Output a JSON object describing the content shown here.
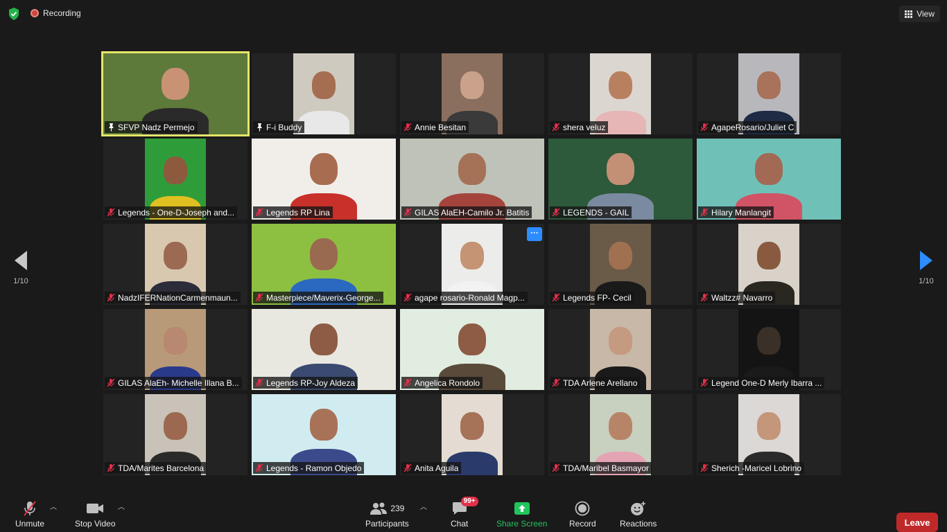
{
  "topbar": {
    "recording_label": "Recording",
    "view_label": "View"
  },
  "pager": {
    "left_page": "1/10",
    "right_page": "1/10"
  },
  "participants": [
    {
      "name": "SFVP Nadz Permejo",
      "icon": "pin-icon",
      "active": true,
      "bg": "#5d7a3a",
      "skin": "#c99275",
      "shirt": "#2a2a2a",
      "wide": true
    },
    {
      "name": "F-i Buddy",
      "icon": "pin-icon",
      "active": false,
      "bg": "#cfcac0",
      "skin": "#a56e52",
      "shirt": "#e8e8e8",
      "wide": false
    },
    {
      "name": "Annie Besitan",
      "icon": "mic-muted-icon",
      "active": false,
      "bg": "#8a6e5e",
      "skin": "#caa18a",
      "shirt": "#3a3a3a",
      "wide": false
    },
    {
      "name": "shera veluz",
      "icon": "mic-muted-icon",
      "active": false,
      "bg": "#dcd6d0",
      "skin": "#b98060",
      "shirt": "#e6b6b6",
      "wide": false
    },
    {
      "name": "AgapeRosario/Juliet C",
      "icon": "mic-muted-icon",
      "active": false,
      "bg": "#b8b8bc",
      "skin": "#a9725b",
      "shirt": "#1f2a44",
      "wide": false
    },
    {
      "name": "Legends - One-D-Joseph and...",
      "icon": "mic-muted-icon",
      "active": false,
      "bg": "#2f9c3a",
      "skin": "#8d5a3e",
      "shirt": "#e0c020",
      "wide": false
    },
    {
      "name": "Legends RP Lina",
      "icon": "mic-muted-icon",
      "active": false,
      "bg": "#f1eeea",
      "skin": "#a86c50",
      "shirt": "#c8302a",
      "wide": true
    },
    {
      "name": "GILAS AlaEH-Camilo Jr. Batitis",
      "icon": "mic-muted-icon",
      "active": false,
      "bg": "#bfc2b8",
      "skin": "#a57258",
      "shirt": "#a4443c",
      "wide": true
    },
    {
      "name": "LEGENDS - GAIL",
      "icon": "mic-muted-icon",
      "active": false,
      "bg": "#2c5a3a",
      "skin": "#c49075",
      "shirt": "#7a8aa0",
      "wide": true
    },
    {
      "name": "Hilary Manlangit",
      "icon": "mic-muted-icon",
      "active": false,
      "bg": "#6fc1b8",
      "skin": "#a26a55",
      "shirt": "#d05466",
      "wide": true
    },
    {
      "name": "NadzIFERNationCarmenmaun...",
      "icon": "mic-muted-icon",
      "active": false,
      "bg": "#d8c8b0",
      "skin": "#9c6a52",
      "shirt": "#2c2c3a",
      "wide": false
    },
    {
      "name": "Masterpiece/Maverix-George...",
      "icon": "mic-muted-icon",
      "active": false,
      "bg": "#8dc040",
      "skin": "#9a6a50",
      "shirt": "#2b68c0",
      "wide": true
    },
    {
      "name": "agape rosario-Ronald Magp...",
      "icon": "mic-muted-icon",
      "active": false,
      "bg": "#ececea",
      "skin": "#c49474",
      "shirt": "#f2f2f2",
      "wide": false
    },
    {
      "name": "Legends FP- Cecil",
      "icon": "mic-muted-icon",
      "active": false,
      "bg": "#6a5a48",
      "skin": "#a07050",
      "shirt": "#1a1a1a",
      "wide": false
    },
    {
      "name": "Waltzz# Navarro",
      "icon": "mic-muted-icon",
      "active": false,
      "bg": "#d8d2c8",
      "skin": "#8a5a40",
      "shirt": "#2a2620",
      "wide": false
    },
    {
      "name": "GILAS AlaEh- Michelle Illana B...",
      "icon": "mic-muted-icon",
      "active": false,
      "bg": "#b89a78",
      "skin": "#b88870",
      "shirt": "#2a3a8a",
      "wide": false
    },
    {
      "name": "Legends RP-Joy Aldeza",
      "icon": "mic-muted-icon",
      "active": false,
      "bg": "#e8e8e0",
      "skin": "#8e5c44",
      "shirt": "#3a4a70",
      "wide": true
    },
    {
      "name": "Angelica Rondolo",
      "icon": "mic-muted-icon",
      "active": false,
      "bg": "#e0ede0",
      "skin": "#8e5c44",
      "shirt": "#5a4a3a",
      "wide": true
    },
    {
      "name": "TDA Arlene Arellano",
      "icon": "mic-muted-icon",
      "active": false,
      "bg": "#c8b8a8",
      "skin": "#c49a80",
      "shirt": "#1a1a1a",
      "wide": false
    },
    {
      "name": "Legend One-D Merly Ibarra ...",
      "icon": "mic-muted-icon",
      "active": false,
      "bg": "#141414",
      "skin": "#3a3028",
      "shirt": "#1a1a1a",
      "wide": false
    },
    {
      "name": "TDA/Marites Barcelona",
      "icon": "mic-muted-icon",
      "active": false,
      "bg": "#c8c2b8",
      "skin": "#9c6850",
      "shirt": "#2a2a2a",
      "wide": false
    },
    {
      "name": "Legends - Ramon Objedo",
      "icon": "mic-muted-icon",
      "active": false,
      "bg": "#d0ecf0",
      "skin": "#a87258",
      "shirt": "#3a4a8a",
      "wide": true
    },
    {
      "name": "Anita Aguila",
      "icon": "mic-muted-icon",
      "active": false,
      "bg": "#e4dcd2",
      "skin": "#a67258",
      "shirt": "#2a3a6a",
      "wide": false
    },
    {
      "name": "TDA/Maribel Basmayor",
      "icon": "mic-muted-icon",
      "active": false,
      "bg": "#c8d0c0",
      "skin": "#b88468",
      "shirt": "#e4a4b4",
      "wide": false
    },
    {
      "name": "Sherich -Maricel Lobrino",
      "icon": "mic-muted-icon",
      "active": false,
      "bg": "#dcd8d6",
      "skin": "#c4967a",
      "shirt": "#2a2a2a",
      "wide": false
    }
  ],
  "toolbar": {
    "unmute_label": "Unmute",
    "stop_video_label": "Stop Video",
    "participants_label": "Participants",
    "participants_count": "239",
    "chat_label": "Chat",
    "chat_badge": "99+",
    "share_screen_label": "Share Screen",
    "record_label": "Record",
    "reactions_label": "Reactions",
    "leave_label": "Leave"
  },
  "colors": {
    "background": "#1a1a1a",
    "active_speaker_border": "#e6e66a",
    "share_green": "#21c45d",
    "leave_red": "#c0292a",
    "accent_blue": "#2d8cff",
    "badge_red": "#e0304a"
  }
}
